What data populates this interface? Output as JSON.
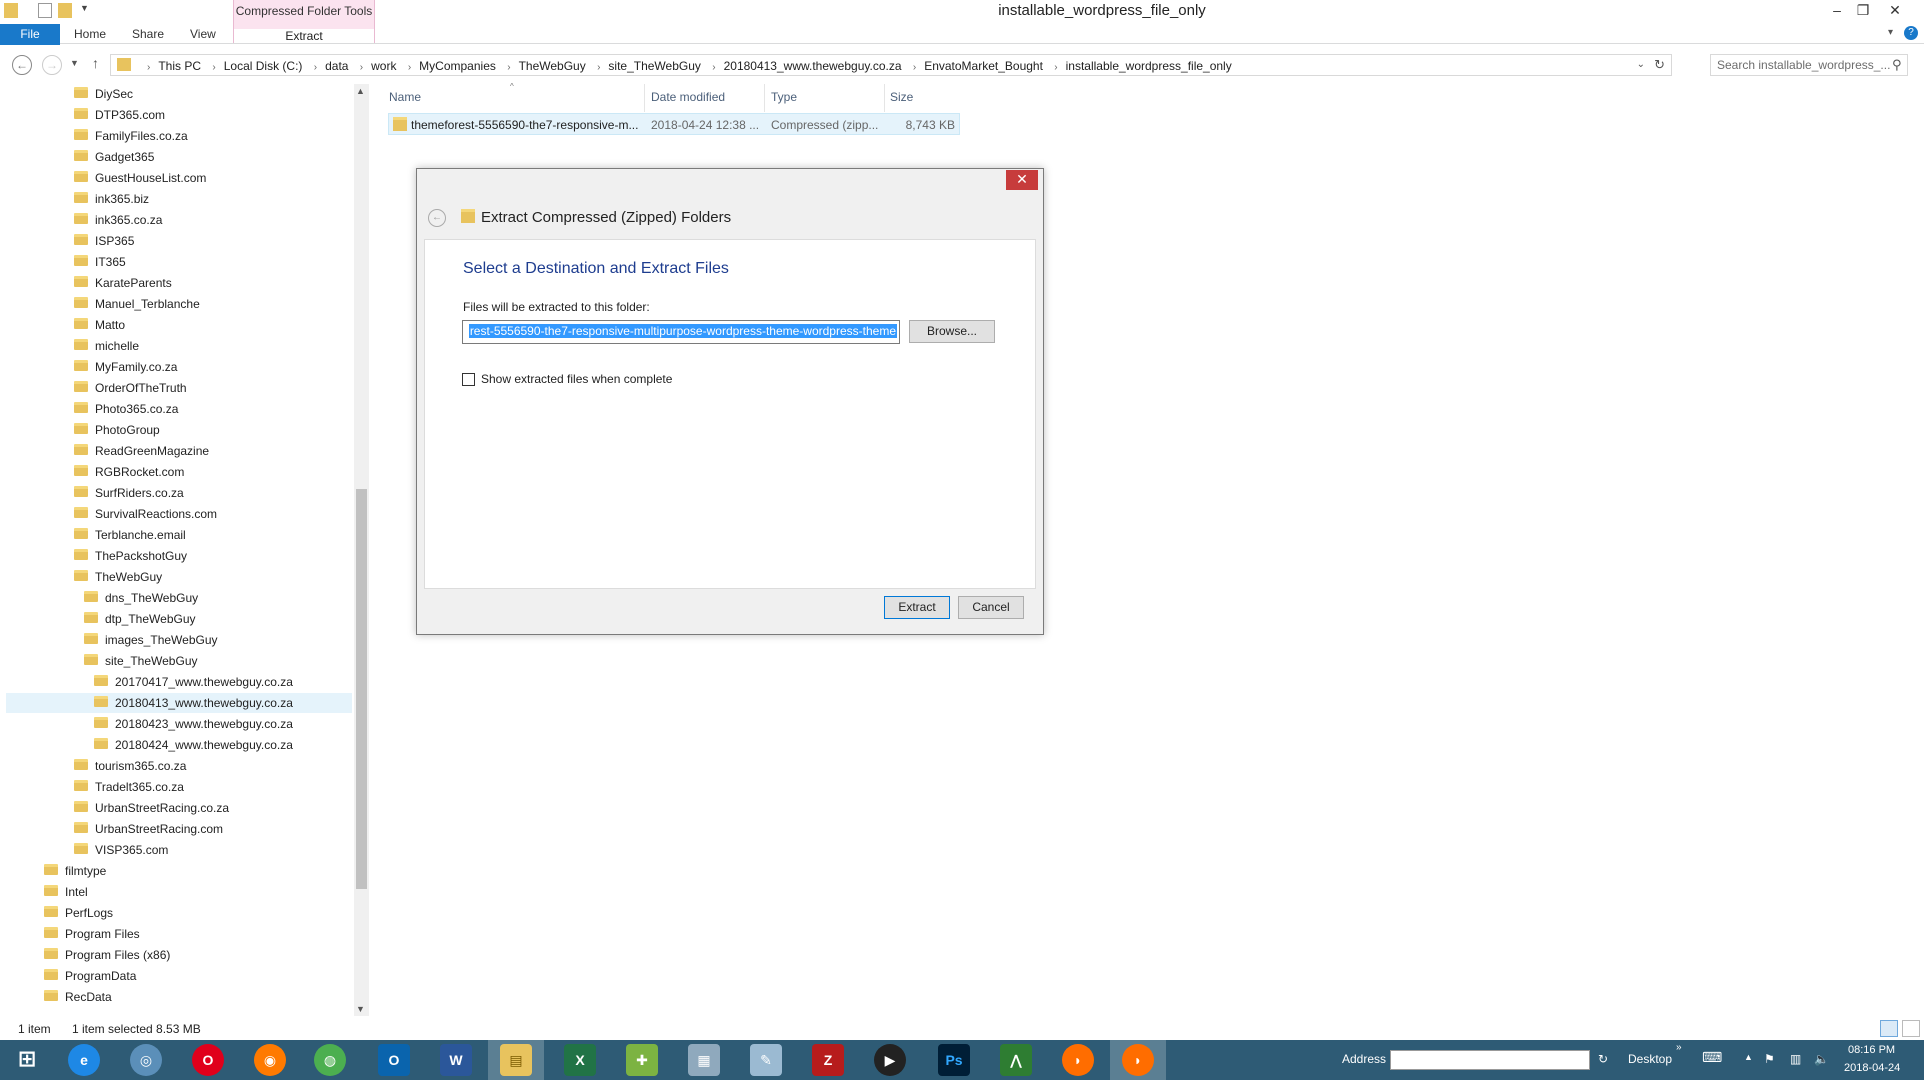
{
  "window": {
    "title": "installable_wordpress_file_only",
    "context_tab_group": "Compressed Folder Tools",
    "context_tab": "Extract"
  },
  "ribbon": {
    "tabs": [
      "File",
      "Home",
      "Share",
      "View"
    ]
  },
  "address": {
    "breadcrumbs": [
      "This PC",
      "Local Disk (C:)",
      "data",
      "work",
      "MyCompanies",
      "TheWebGuy",
      "site_TheWebGuy",
      "20180413_www.thewebguy.co.za",
      "EnvatoMarket_Bought",
      "installable_wordpress_file_only"
    ],
    "search_placeholder": "Search installable_wordpress_..."
  },
  "tree": {
    "items": [
      {
        "label": "DiySec",
        "level": 2
      },
      {
        "label": "DTP365.com",
        "level": 2
      },
      {
        "label": "FamilyFiles.co.za",
        "level": 2
      },
      {
        "label": "Gadget365",
        "level": 2
      },
      {
        "label": "GuestHouseList.com",
        "level": 2
      },
      {
        "label": "ink365.biz",
        "level": 2
      },
      {
        "label": "ink365.co.za",
        "level": 2
      },
      {
        "label": "ISP365",
        "level": 2
      },
      {
        "label": "IT365",
        "level": 2
      },
      {
        "label": "KarateParents",
        "level": 2
      },
      {
        "label": "Manuel_Terblanche",
        "level": 2
      },
      {
        "label": "Matto",
        "level": 2
      },
      {
        "label": "michelle",
        "level": 2
      },
      {
        "label": "MyFamily.co.za",
        "level": 2
      },
      {
        "label": "OrderOfTheTruth",
        "level": 2
      },
      {
        "label": "Photo365.co.za",
        "level": 2
      },
      {
        "label": "PhotoGroup",
        "level": 2
      },
      {
        "label": "ReadGreenMagazine",
        "level": 2
      },
      {
        "label": "RGBRocket.com",
        "level": 2
      },
      {
        "label": "SurfRiders.co.za",
        "level": 2
      },
      {
        "label": "SurvivalReactions.com",
        "level": 2
      },
      {
        "label": "Terblanche.email",
        "level": 2
      },
      {
        "label": "ThePackshotGuy",
        "level": 2
      },
      {
        "label": "TheWebGuy",
        "level": 2
      },
      {
        "label": "dns_TheWebGuy",
        "level": 3
      },
      {
        "label": "dtp_TheWebGuy",
        "level": 3
      },
      {
        "label": "images_TheWebGuy",
        "level": 3
      },
      {
        "label": "site_TheWebGuy",
        "level": 3
      },
      {
        "label": "20170417_www.thewebguy.co.za",
        "level": 4
      },
      {
        "label": "20180413_www.thewebguy.co.za",
        "level": 4,
        "selected": true
      },
      {
        "label": "20180423_www.thewebguy.co.za",
        "level": 4
      },
      {
        "label": "20180424_www.thewebguy.co.za",
        "level": 4
      },
      {
        "label": "tourism365.co.za",
        "level": 2
      },
      {
        "label": "Tradelt365.co.za",
        "level": 2
      },
      {
        "label": "UrbanStreetRacing.co.za",
        "level": 2
      },
      {
        "label": "UrbanStreetRacing.com",
        "level": 2
      },
      {
        "label": "VISP365.com",
        "level": 2
      },
      {
        "label": "filmtype",
        "level": 1
      },
      {
        "label": "Intel",
        "level": 1
      },
      {
        "label": "PerfLogs",
        "level": 1
      },
      {
        "label": "Program Files",
        "level": 1
      },
      {
        "label": "Program Files (x86)",
        "level": 1
      },
      {
        "label": "ProgramData",
        "level": 1
      },
      {
        "label": "RecData",
        "level": 1
      }
    ]
  },
  "list": {
    "columns": [
      "Name",
      "Date modified",
      "Type",
      "Size"
    ],
    "rows": [
      {
        "name": "themeforest-5556590-the7-responsive-m...",
        "date": "2018-04-24 12:38 ...",
        "type": "Compressed (zipp...",
        "size": "8,743 KB"
      }
    ]
  },
  "dialog": {
    "title": "Extract Compressed (Zipped) Folders",
    "heading": "Select a Destination and Extract Files",
    "folder_label": "Files will be extracted to this folder:",
    "folder_value": "rest-5556590-the7-responsive-multipurpose-wordpress-theme-wordpress-theme",
    "browse_label": "Browse...",
    "checkbox_label": "Show extracted files when complete",
    "extract_label": "Extract",
    "cancel_label": "Cancel",
    "close_glyph": "✕"
  },
  "status": {
    "count": "1 item",
    "selection": "1 item selected  8.53 MB"
  },
  "taskbar": {
    "address_label": "Address",
    "desktop_label": "Desktop",
    "time": "08:16 PM",
    "date": "2018-04-24"
  }
}
